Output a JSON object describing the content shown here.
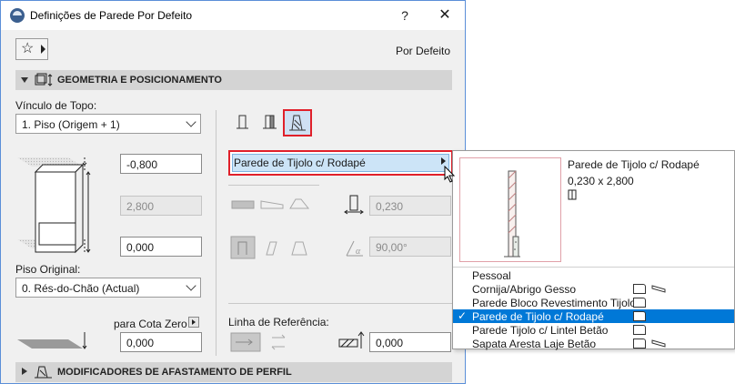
{
  "window": {
    "title": "Definições de Parede Por Defeito",
    "help_label": "?",
    "close_label": "✕"
  },
  "favorites": {
    "star_glyph": "☆"
  },
  "mode_label": "Por Defeito",
  "section_geometry": {
    "title": "GEOMETRIA E POSICIONAMENTO"
  },
  "section_offset": {
    "title": "MODIFICADORES DE AFASTAMENTO DE PERFIL"
  },
  "top_link": {
    "label": "Vínculo de Topo:",
    "value": "1. Piso (Origem + 1)"
  },
  "top_offset": "-0,800",
  "height": "2,800",
  "bottom_offset": "0,000",
  "home_story": {
    "label": "Piso Original:",
    "value": "0. Rés-do-Chão (Actual)"
  },
  "zero_ref": {
    "label": "para Cota Zero",
    "value": "0,000"
  },
  "profile": {
    "selected": "Parede de Tijolo c/ Rodapé"
  },
  "thickness": "0,230",
  "angle": "90,00°",
  "reference_line": {
    "label": "Linha de Referência:",
    "offset": "0,000"
  },
  "popup": {
    "preview_title": "Parede de Tijolo c/ Rodapé",
    "preview_dims": "0,230 x 2,800",
    "items": [
      {
        "label": "Pessoal",
        "selected": false,
        "icons": 0
      },
      {
        "label": "Cornija/Abrigo Gesso",
        "selected": false,
        "icons": 2
      },
      {
        "label": "Parede Bloco Revestimento Tijolo",
        "selected": false,
        "icons": 1
      },
      {
        "label": "Parede de Tijolo c/ Rodapé",
        "selected": true,
        "icons": 1
      },
      {
        "label": "Parede Tijolo c/ Lintel Betão",
        "selected": false,
        "icons": 1
      },
      {
        "label": "Sapata Aresta Laje Betão",
        "selected": false,
        "icons": 2
      }
    ],
    "check_glyph": "✓"
  },
  "colors": {
    "accent_red": "#e0202a",
    "selection_blue": "#0078d7",
    "highlight_blue": "#cce4f7"
  }
}
